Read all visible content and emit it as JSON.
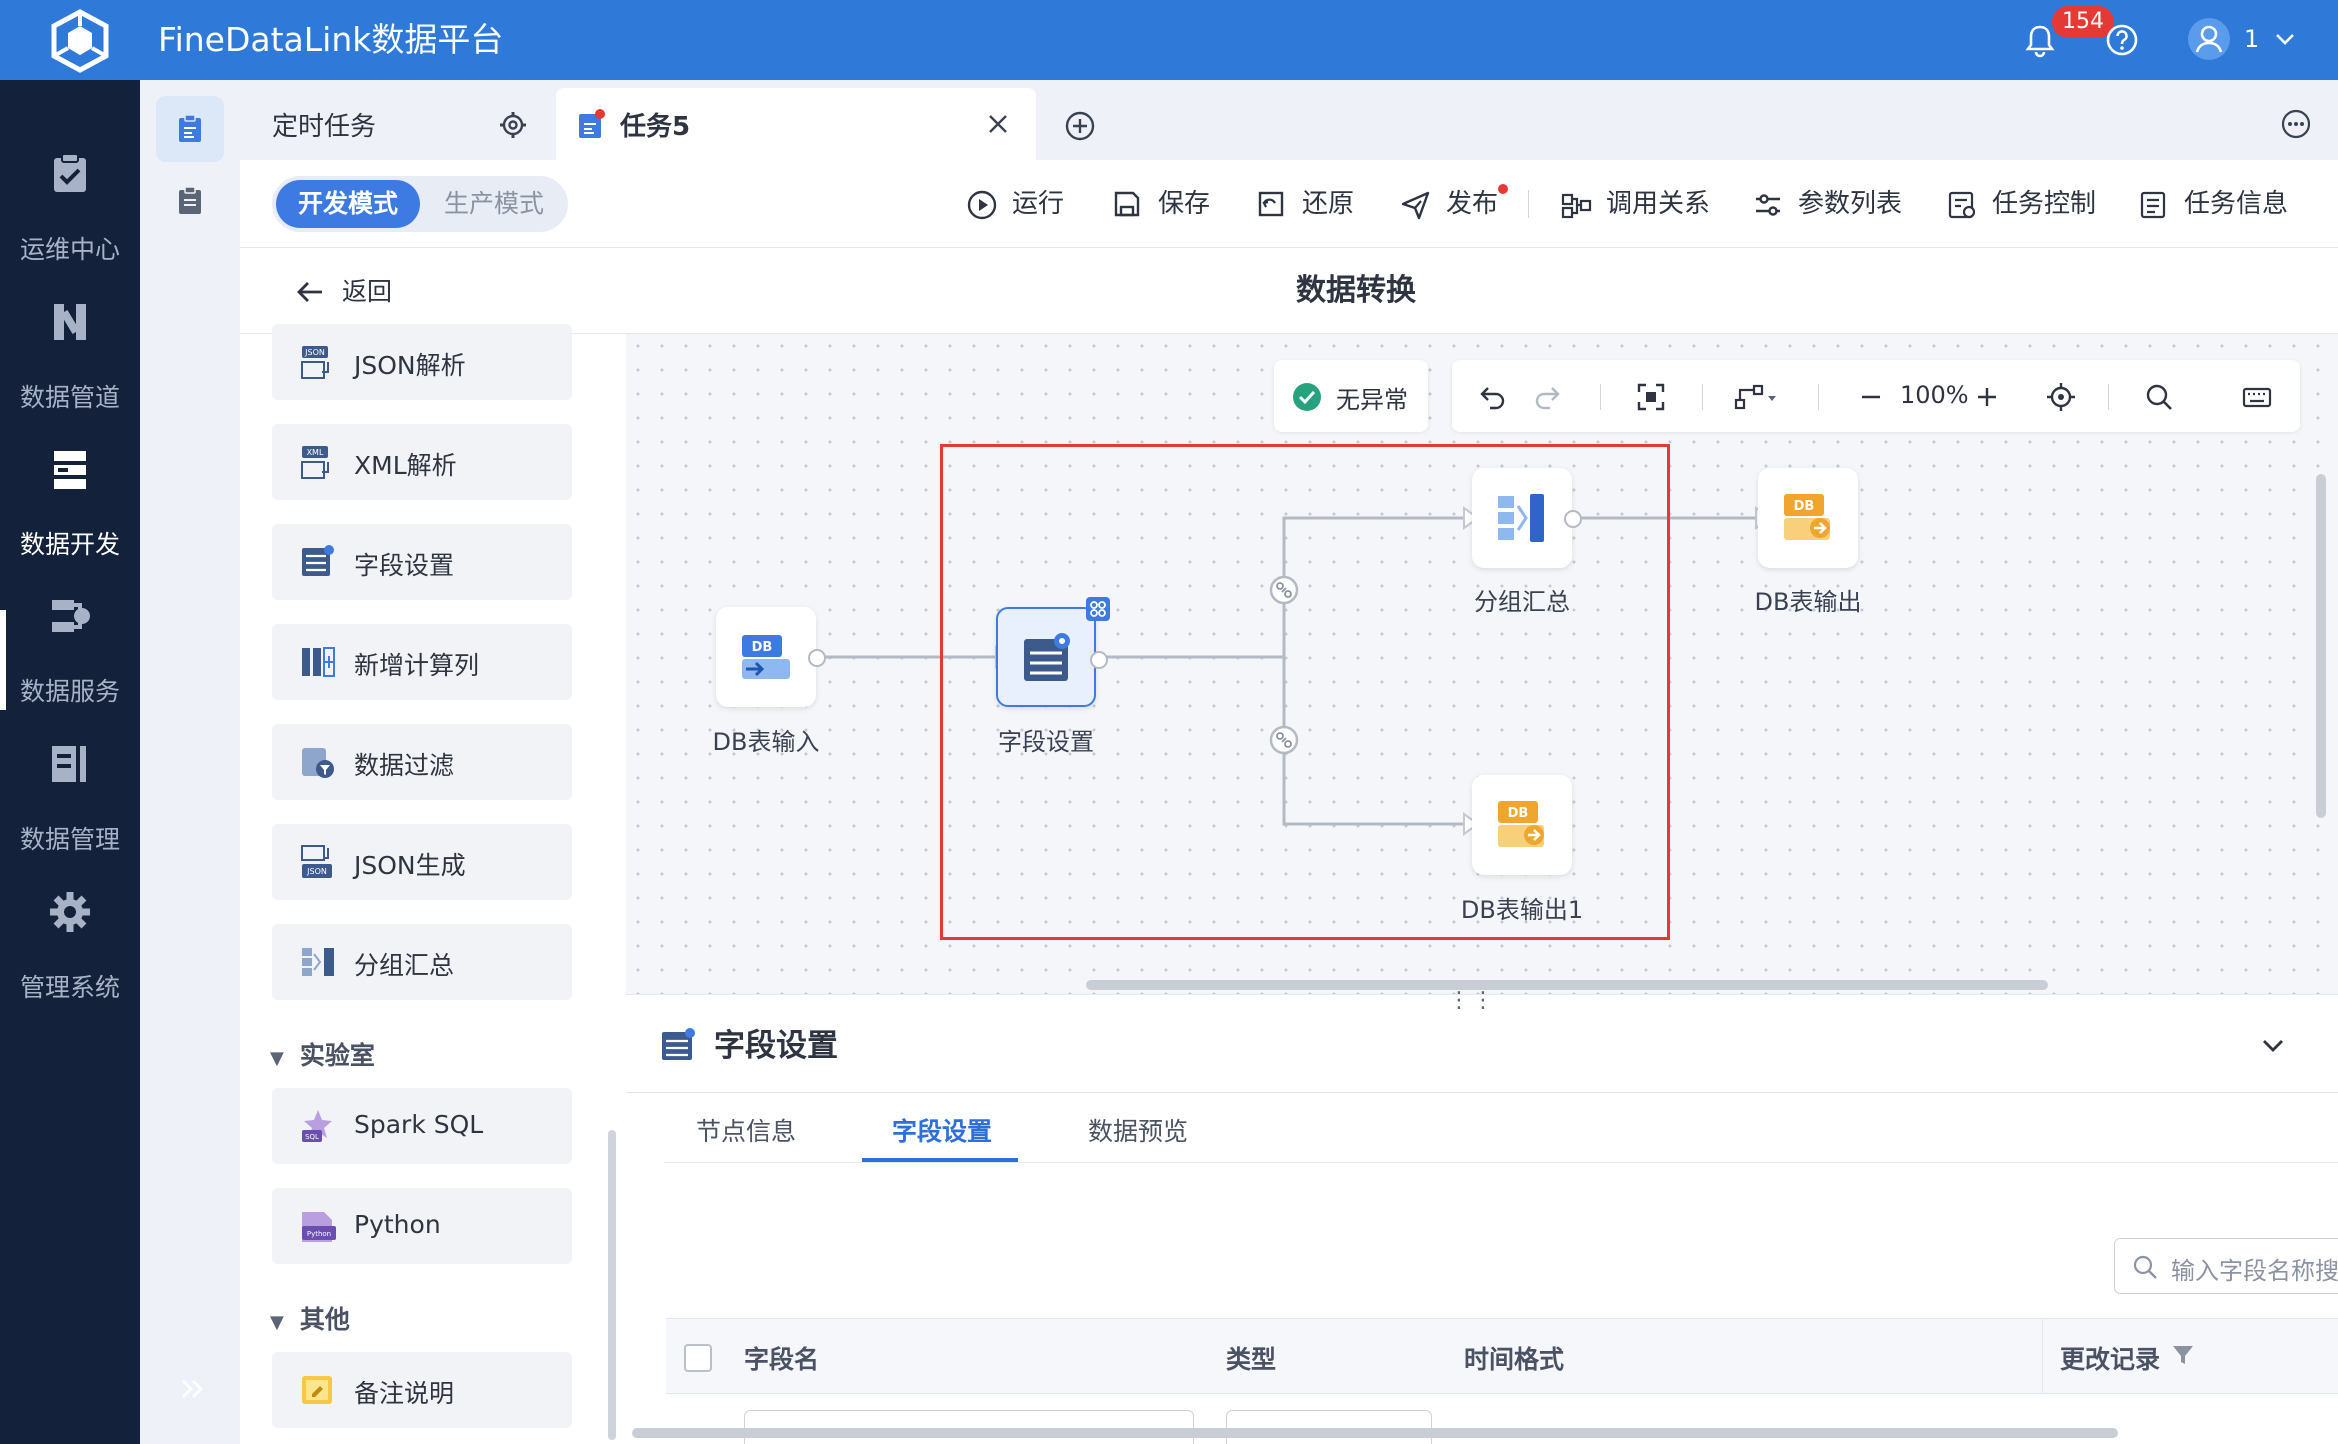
{
  "app": {
    "title": "FineDataLink数据平台",
    "notification_count": "154",
    "user_name": "1"
  },
  "colors": {
    "header": "#2f7ad8",
    "nav_bg": "#14213a",
    "accent": "#3d7be3",
    "selection": "#e53935",
    "db_orange": "#f0a52c"
  },
  "left_nav": [
    {
      "label": "运维中心",
      "icon": "clipboard-check-icon"
    },
    {
      "label": "数据管道",
      "icon": "pipeline-icon"
    },
    {
      "label": "数据开发",
      "icon": "data-dev-icon",
      "active": true
    },
    {
      "label": "数据服务",
      "icon": "data-service-icon"
    },
    {
      "label": "数据管理",
      "icon": "data-manage-icon"
    },
    {
      "label": "管理系统",
      "icon": "gear-icon"
    }
  ],
  "tabs": [
    {
      "label": "定时任务"
    },
    {
      "label": "任务5",
      "active": true
    }
  ],
  "mode": {
    "dev": "开发模式",
    "prod": "生产模式"
  },
  "toolbar": {
    "run": "运行",
    "save": "保存",
    "restore": "还原",
    "publish": "发布",
    "relations": "调用关系",
    "params": "参数列表",
    "control": "任务控制",
    "info": "任务信息"
  },
  "page": {
    "back": "返回",
    "title": "数据转换"
  },
  "palette": {
    "items": [
      "JSON解析",
      "XML解析",
      "字段设置",
      "新增计算列",
      "数据过滤",
      "JSON生成",
      "分组汇总"
    ],
    "lab_section": "实验室",
    "lab_items": [
      "Spark SQL",
      "Python"
    ],
    "other_section": "其他",
    "other_items": [
      "备注说明"
    ]
  },
  "canvas": {
    "status": "无异常",
    "zoom": "100%",
    "nodes": {
      "db_input": "DB表输入",
      "field_settings": "字段设置",
      "group_summary": "分组汇总",
      "db_output": "DB表输出",
      "db_output1": "DB表输出1"
    }
  },
  "detail": {
    "title": "字段设置",
    "tabs": [
      "节点信息",
      "字段设置",
      "数据预览"
    ],
    "active_tab": "字段设置",
    "search_placeholder": "输入字段名称搜",
    "columns": [
      "字段名",
      "类型",
      "时间格式",
      "更改记录"
    ]
  }
}
